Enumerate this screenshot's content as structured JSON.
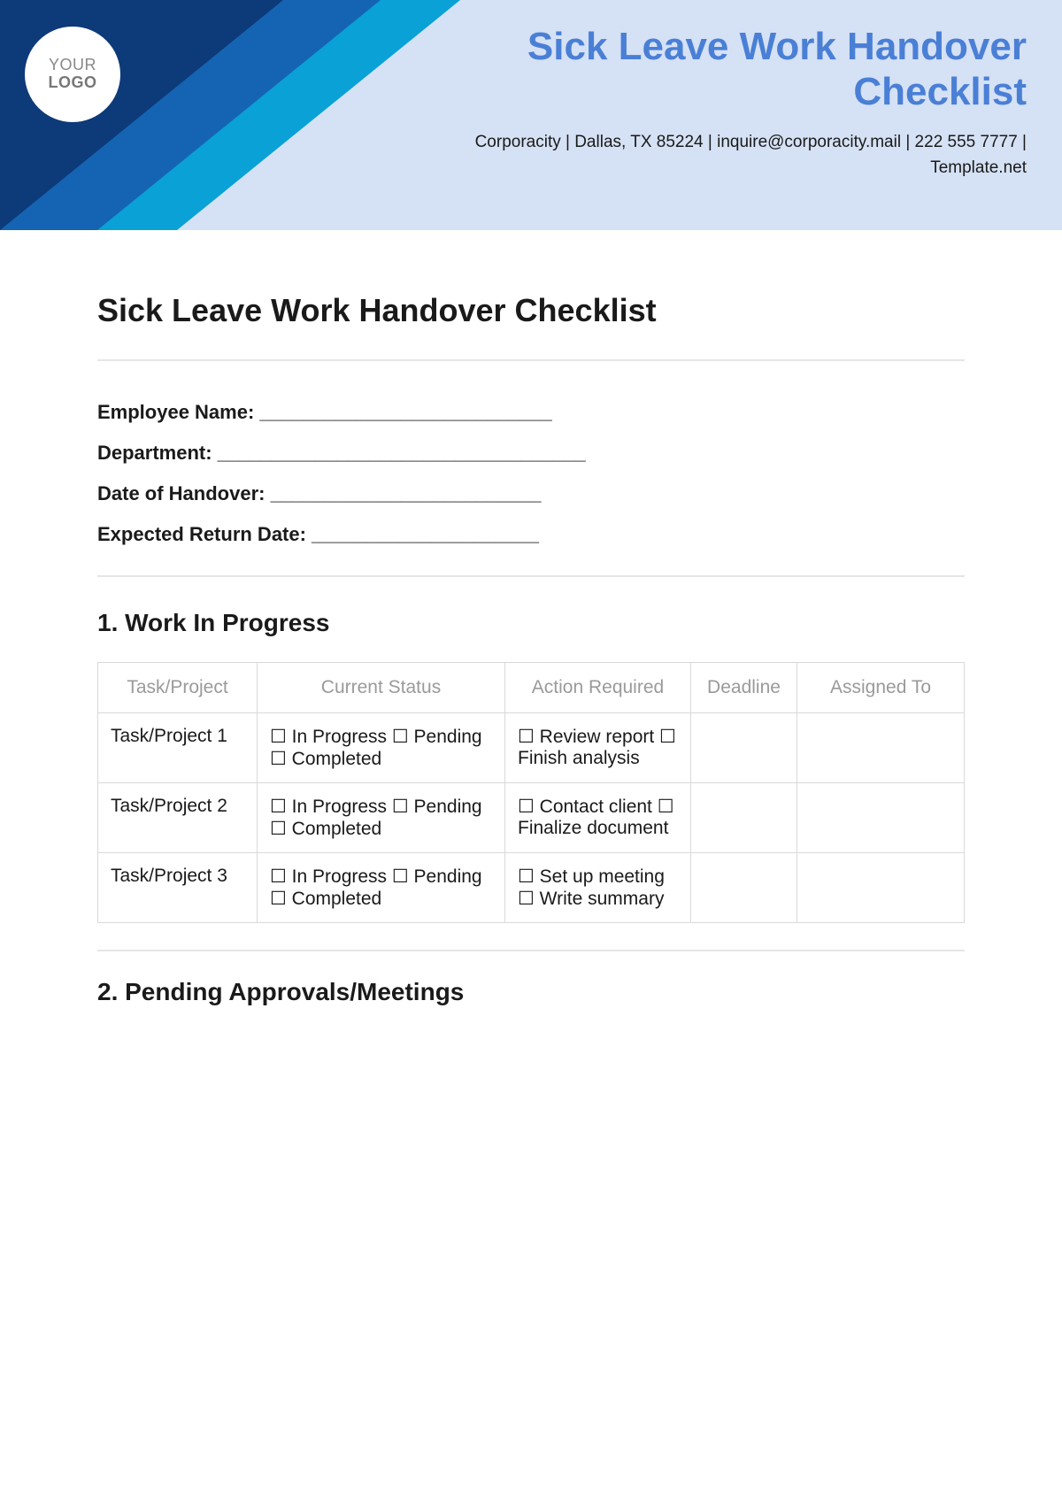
{
  "header": {
    "logo_line1": "YOUR",
    "logo_line2": "LOGO",
    "title_line1": "Sick Leave Work Handover",
    "title_line2": "Checklist",
    "subtitle": "Corporacity | Dallas, TX 85224 | inquire@corporacity.mail | 222 555 7777 | Template.net"
  },
  "document": {
    "title": "Sick Leave Work Handover Checklist",
    "fields": {
      "employee_name": "Employee Name: ___________________________",
      "department": "Department: __________________________________",
      "handover_date": "Date of Handover: _________________________",
      "return_date": "Expected Return Date: _____________________"
    },
    "section1": {
      "heading": "1. Work In Progress",
      "columns": [
        "Task/Project",
        "Current Status",
        "Action Required",
        "Deadline",
        "Assigned To"
      ],
      "rows": [
        {
          "task": "Task/Project 1",
          "status": "☐ In Progress ☐ Pending ☐ Completed",
          "action": "☐ Review report ☐ Finish analysis",
          "deadline": "",
          "assigned": ""
        },
        {
          "task": "Task/Project 2",
          "status": "☐ In Progress ☐ Pending ☐ Completed",
          "action": "☐ Contact client ☐ Finalize document",
          "deadline": "",
          "assigned": ""
        },
        {
          "task": "Task/Project 3",
          "status": "☐ In Progress ☐ Pending ☐ Completed",
          "action": "☐ Set up meeting ☐ Write summary",
          "deadline": "",
          "assigned": ""
        }
      ]
    },
    "section2": {
      "heading": "2. Pending Approvals/Meetings"
    }
  }
}
